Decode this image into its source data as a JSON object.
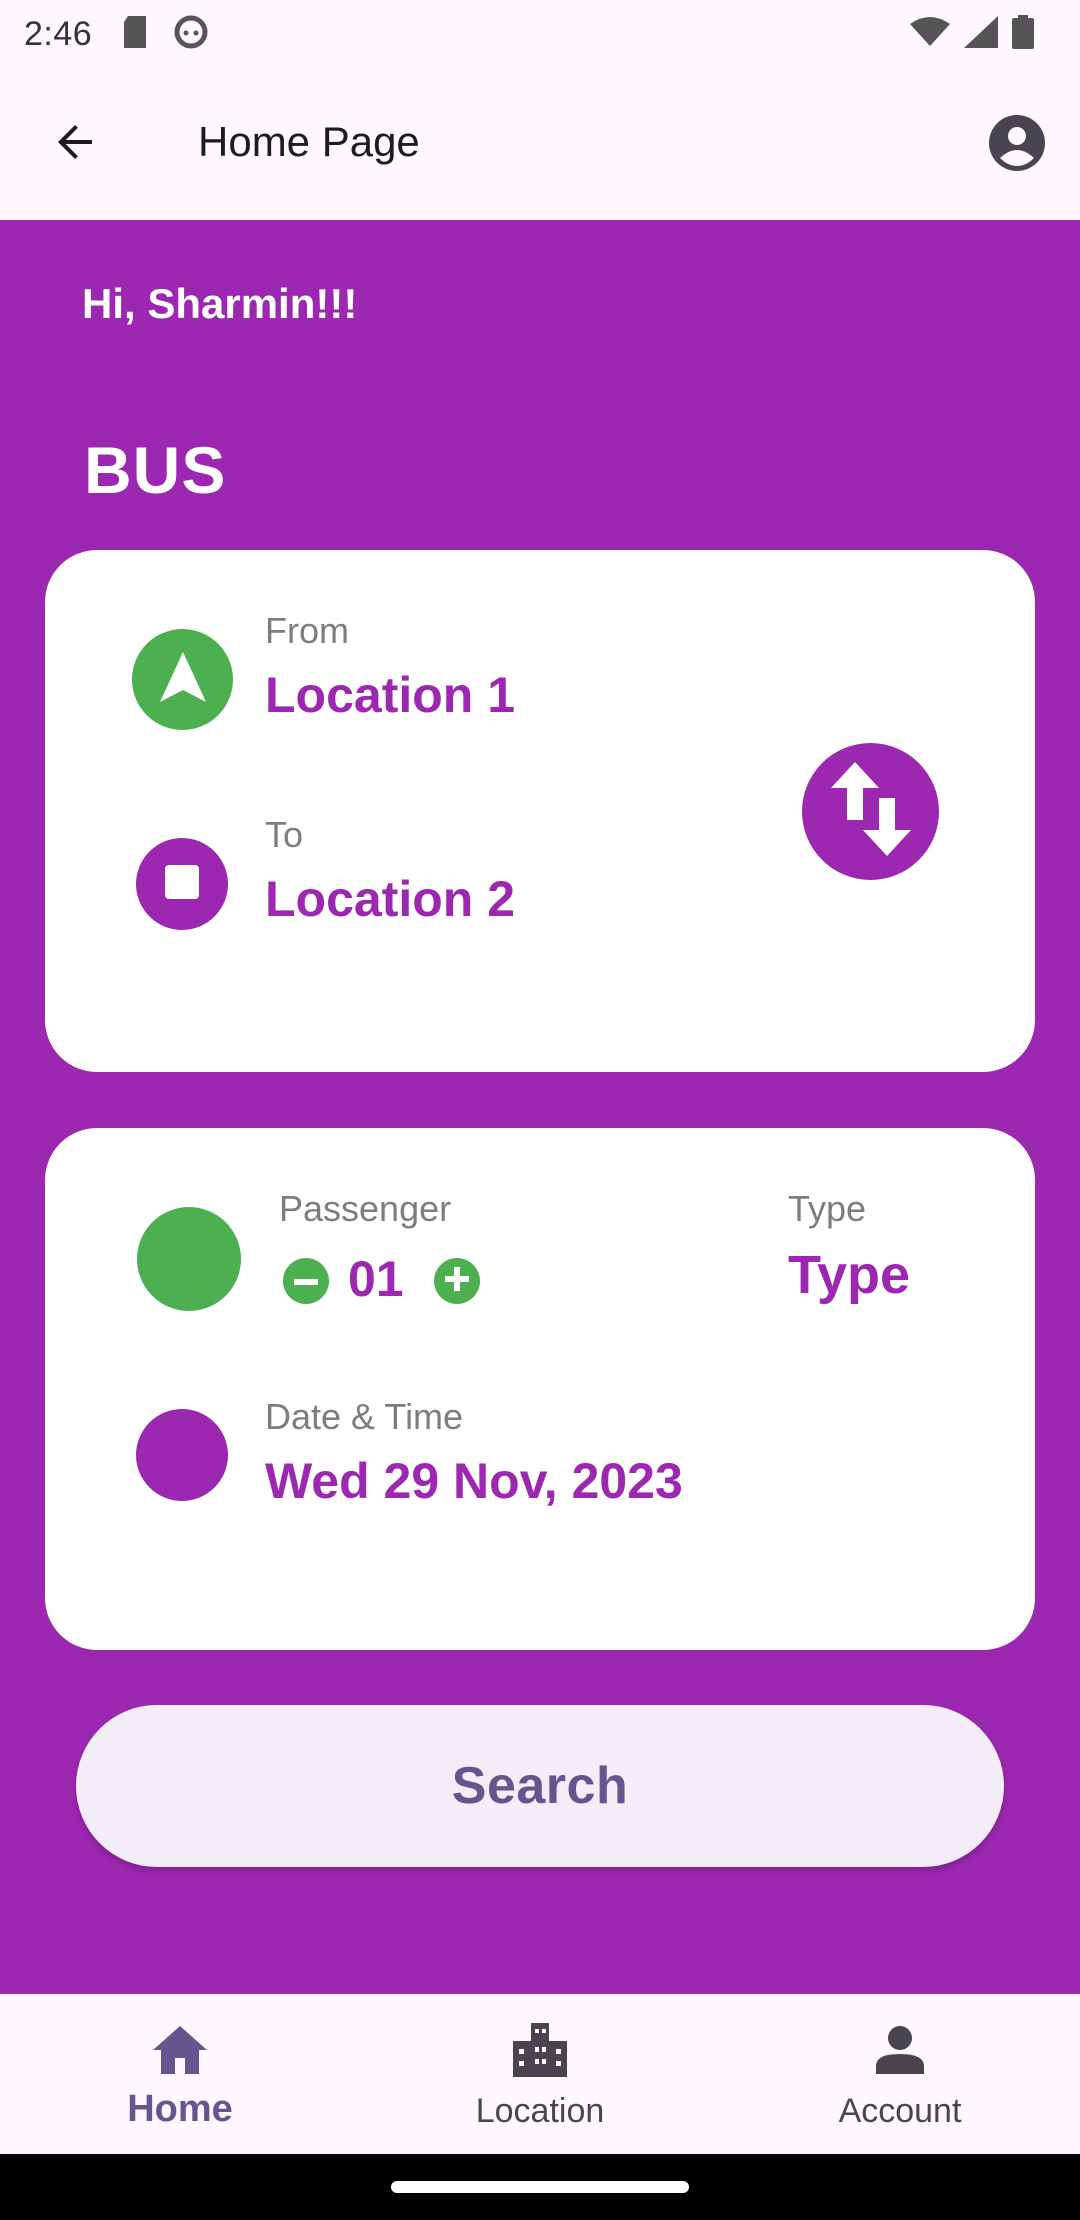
{
  "status_bar": {
    "time": "2:46",
    "icons_left": [
      "sd-card-icon",
      "android-icon"
    ],
    "icons_right": [
      "wifi-icon",
      "signal-icon",
      "battery-icon"
    ]
  },
  "app_bar": {
    "title": "Home Page",
    "back_icon": "arrow-back-icon",
    "profile_icon": "account-circle-icon"
  },
  "greeting": "Hi, Sharmin!!!",
  "mode_title": "BUS",
  "route": {
    "from_label": "From",
    "from_value": "Location 1",
    "to_label": "To",
    "to_value": "Location 2",
    "swap_icon": "swap-vert-icon"
  },
  "details": {
    "passenger_label": "Passenger",
    "passenger_count": "01",
    "type_label": "Type",
    "type_value": "Type",
    "datetime_label": "Date & Time",
    "datetime_value": "Wed 29 Nov, 2023"
  },
  "search": {
    "label": "Search"
  },
  "bottom_nav": {
    "items": [
      {
        "label": "Home",
        "icon": "home-icon",
        "active": true
      },
      {
        "label": "Location",
        "icon": "location-city-icon",
        "active": false
      },
      {
        "label": "Account",
        "icon": "person-icon",
        "active": false
      }
    ]
  },
  "colors": {
    "primary": "#9C27B0",
    "green": "#4CAF50",
    "surface": "#FEF7FF",
    "button_bg": "#F3EDF7",
    "button_text": "#65558F"
  }
}
